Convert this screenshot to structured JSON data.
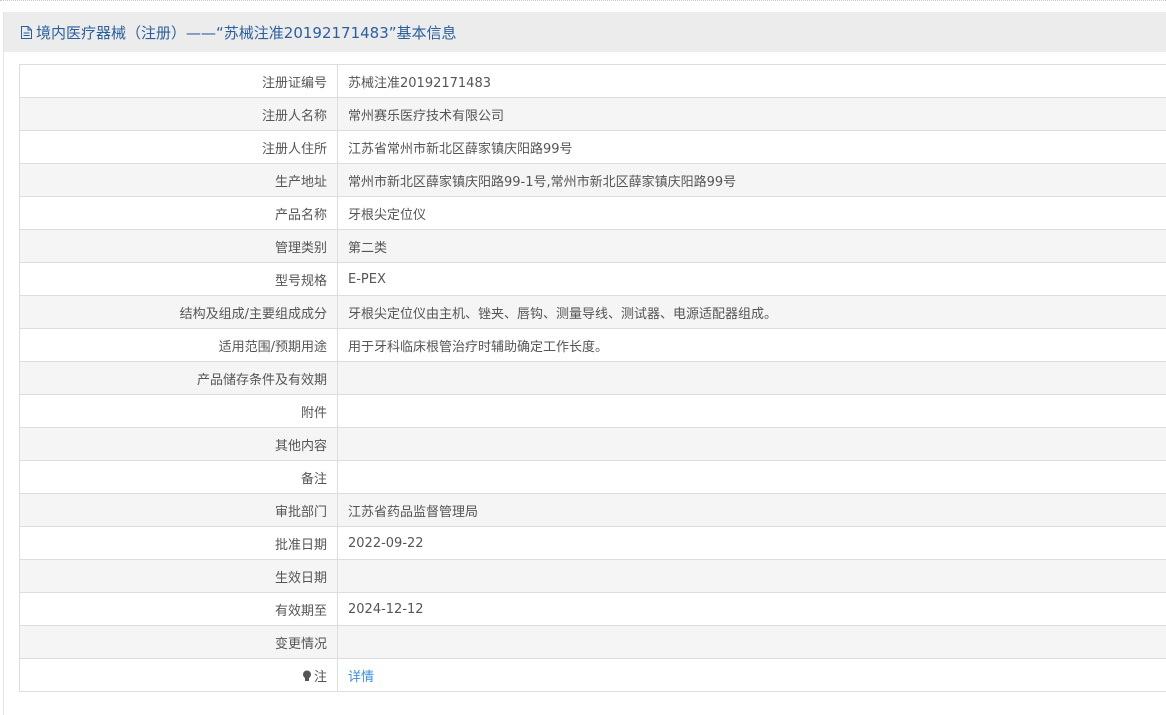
{
  "header": {
    "title": "境内医疗器械（注册）——“苏械注准20192171483”基本信息",
    "icon": "document-icon"
  },
  "rows": [
    {
      "key": "注册证编号",
      "value": "苏械注准20192171483"
    },
    {
      "key": "注册人名称",
      "value": "常州赛乐医疗技术有限公司"
    },
    {
      "key": "注册人住所",
      "value": "江苏省常州市新北区薛家镇庆阳路99号"
    },
    {
      "key": "生产地址",
      "value": "常州市新北区薛家镇庆阳路99-1号,常州市新北区薛家镇庆阳路99号"
    },
    {
      "key": "产品名称",
      "value": "牙根尖定位仪"
    },
    {
      "key": "管理类别",
      "value": "第二类"
    },
    {
      "key": "型号规格",
      "value": "E-PEX"
    },
    {
      "key": "结构及组成/主要组成成分",
      "value": "牙根尖定位仪由主机、锉夹、唇钩、测量导线、测试器、电源适配器组成。"
    },
    {
      "key": "适用范围/预期用途",
      "value": "用于牙科临床根管治疗时辅助确定工作长度。"
    },
    {
      "key": "产品储存条件及有效期",
      "value": ""
    },
    {
      "key": "附件",
      "value": ""
    },
    {
      "key": "其他内容",
      "value": ""
    },
    {
      "key": "备注",
      "value": ""
    },
    {
      "key": "审批部门",
      "value": "江苏省药品监督管理局"
    },
    {
      "key": "批准日期",
      "value": "2022-09-22"
    },
    {
      "key": "生效日期",
      "value": ""
    },
    {
      "key": "有效期至",
      "value": "2024-12-12"
    },
    {
      "key": "变更情况",
      "value": ""
    }
  ],
  "note": {
    "key": "注",
    "icon": "lightbulb-icon",
    "link_label": "详情"
  },
  "colors": {
    "title_text": "#2a5f9e",
    "link": "#3a8ee6",
    "header_bg": "#ececec",
    "row_alt_bg": "#f5f5f5"
  }
}
